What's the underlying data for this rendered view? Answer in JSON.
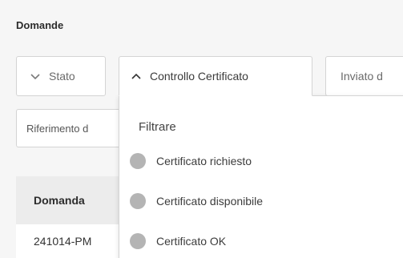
{
  "section": {
    "title": "Domande"
  },
  "filters": {
    "stato": "Stato",
    "controllo_certificato": "Controllo Certificato",
    "inviato": "Inviato d"
  },
  "search": {
    "value": "Riferimento d"
  },
  "table": {
    "header": "Domanda",
    "rows": [
      "241014-PM"
    ]
  },
  "dropdown": {
    "title": "Filtrare",
    "options": [
      {
        "label": "Certificato richiesto",
        "color": "#b4b4b4"
      },
      {
        "label": "Certificato disponibile",
        "color": "#b4b4b4"
      },
      {
        "label": "Certificato OK",
        "color": "#b4b4b4"
      }
    ]
  }
}
